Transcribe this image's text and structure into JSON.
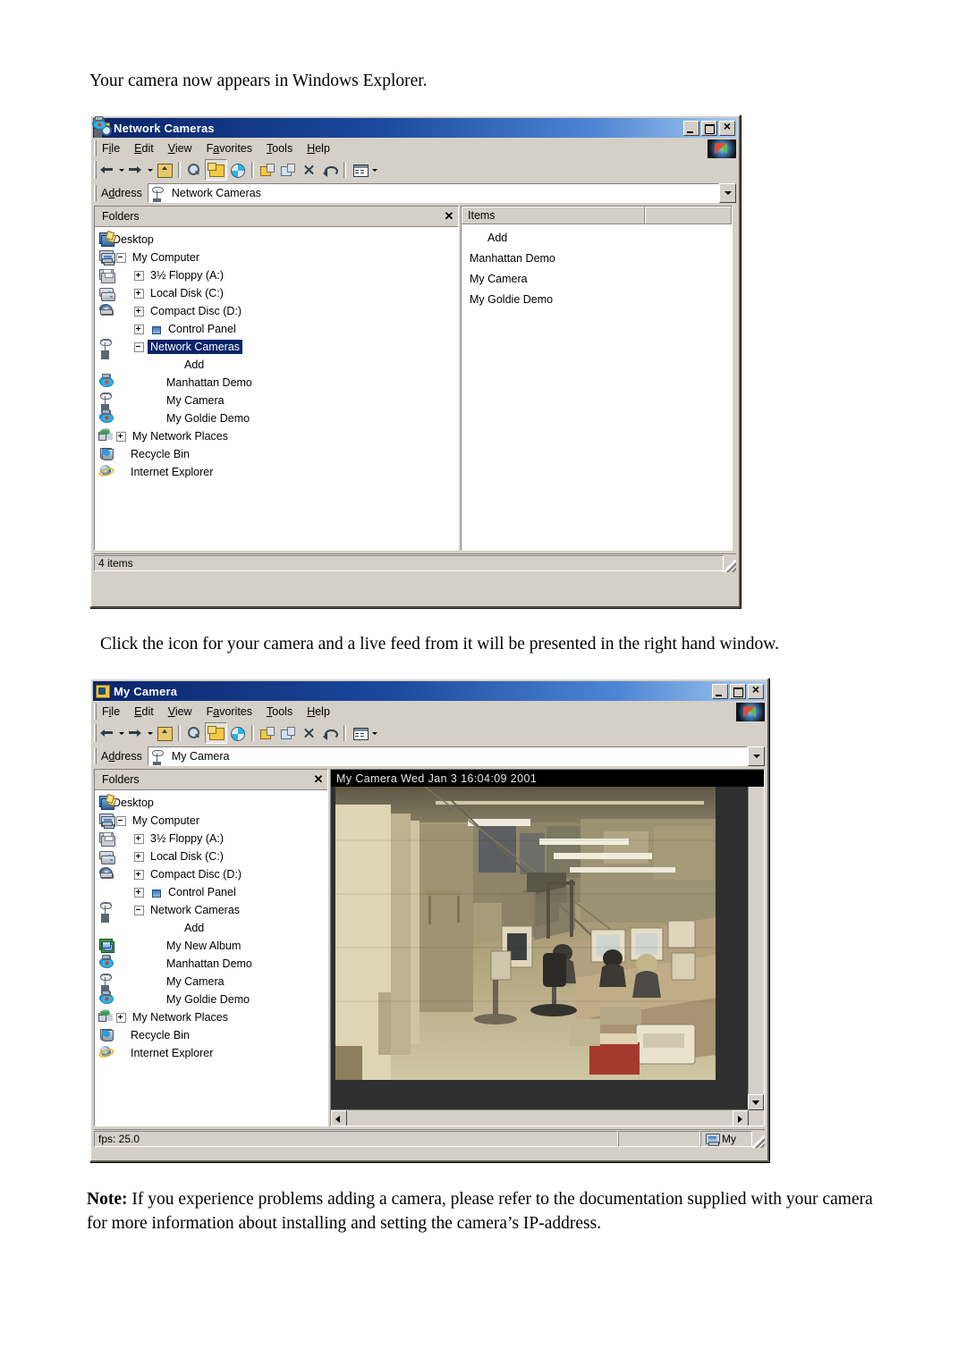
{
  "document": {
    "para_1": "Your camera now appears in Windows Explorer.",
    "para_2": "Click the icon for your camera and a live feed from it will be presented in the right hand window.",
    "note_label": "Note:",
    "note_body": " If you experience problems adding a camera, please refer to the documentation supplied with your camera for more information about installing and setting the camera’s IP-address."
  },
  "window1": {
    "title": "Network Cameras",
    "title_icon": "folder-search-icon",
    "caption_buttons": [
      "minimize",
      "maximize",
      "close"
    ],
    "menu": [
      {
        "pre": "F",
        "key": "i",
        "post": "le",
        "label": "File"
      },
      {
        "pre": "",
        "key": "E",
        "post": "dit",
        "label": "Edit"
      },
      {
        "pre": "",
        "key": "V",
        "post": "iew",
        "label": "View"
      },
      {
        "pre": "F",
        "key": "a",
        "post": "vorites",
        "label": "Favorites"
      },
      {
        "pre": "",
        "key": "T",
        "post": "ools",
        "label": "Tools"
      },
      {
        "pre": "",
        "key": "H",
        "post": "elp",
        "label": "Help"
      }
    ],
    "toolbar": [
      {
        "name": "back-button",
        "glyph": "g-back",
        "caret": true,
        "active": false
      },
      {
        "name": "forward-button",
        "glyph": "g-fwd",
        "caret": true,
        "active": false
      },
      {
        "name": "up-one-level-button",
        "glyph": "g-up",
        "caret": false,
        "active": false
      },
      {
        "name": "search-button",
        "glyph": "g-search",
        "caret": false,
        "active": false
      },
      {
        "name": "folders-button",
        "glyph": "g-folders",
        "caret": false,
        "active": true
      },
      {
        "name": "history-button",
        "glyph": "g-history",
        "caret": false,
        "active": false
      },
      {
        "name": "move-to-button",
        "glyph": "g-move",
        "caret": false,
        "active": false
      },
      {
        "name": "copy-to-button",
        "glyph": "g-copy",
        "caret": false,
        "active": false
      },
      {
        "name": "delete-button",
        "glyph": "g-del",
        "caret": false,
        "active": false
      },
      {
        "name": "undo-button",
        "glyph": "g-undo",
        "caret": false,
        "active": false
      },
      {
        "name": "views-button",
        "glyph": "g-views",
        "caret": true,
        "active": false
      }
    ],
    "address": {
      "label": "Address",
      "value": "Network Cameras",
      "icon": "network-camera-icon"
    },
    "folders_panel": {
      "title": "Folders",
      "close_label": "✕"
    },
    "tree": [
      {
        "label": "Desktop",
        "indent": 0,
        "toggle": "none",
        "icon": "ico-desktop",
        "selected": false
      },
      {
        "label": "My Computer",
        "indent": 1,
        "toggle": "minus",
        "icon": "ico-mycomputer",
        "selected": false
      },
      {
        "label": "3½ Floppy (A:)",
        "indent": 2,
        "toggle": "plus",
        "icon": "ico-floppy",
        "selected": false
      },
      {
        "label": "Local Disk (C:)",
        "indent": 2,
        "toggle": "plus",
        "icon": "ico-disk",
        "selected": false
      },
      {
        "label": "Compact Disc (D:)",
        "indent": 2,
        "toggle": "plus",
        "icon": "ico-cd",
        "selected": false
      },
      {
        "label": "Control Panel",
        "indent": 2,
        "toggle": "plus",
        "icon": "ico-cpanel",
        "selected": false
      },
      {
        "label": "Network Cameras",
        "indent": 2,
        "toggle": "minus",
        "icon": "ico-netcam",
        "selected": true
      },
      {
        "label": "Add",
        "indent": 3,
        "toggle": "none",
        "icon": "ico-add",
        "selected": false
      },
      {
        "label": "Manhattan Demo",
        "indent": 3,
        "toggle": "none",
        "icon": "ico-democam",
        "selected": false
      },
      {
        "label": "My Camera",
        "indent": 3,
        "toggle": "none",
        "icon": "ico-netcam",
        "selected": false
      },
      {
        "label": "My Goldie Demo",
        "indent": 3,
        "toggle": "none",
        "icon": "ico-democam",
        "selected": false
      },
      {
        "label": "My Network Places",
        "indent": 1,
        "toggle": "plus",
        "icon": "ico-netplaces",
        "selected": false
      },
      {
        "label": "Recycle Bin",
        "indent": 1,
        "toggle": "none",
        "icon": "ico-recycle",
        "selected": false
      },
      {
        "label": "Internet Explorer",
        "indent": 1,
        "toggle": "none",
        "icon": "ico-ie",
        "selected": false
      }
    ],
    "list": {
      "column_header": "Items",
      "rows": [
        {
          "label": "Add",
          "icon": "ico-add"
        },
        {
          "label": "Manhattan Demo",
          "icon": "ico-democam"
        },
        {
          "label": "My Camera",
          "icon": "ico-netcam"
        },
        {
          "label": "My Goldie Demo",
          "icon": "ico-democam"
        }
      ]
    },
    "statusbar": {
      "text": "4 items"
    }
  },
  "window2": {
    "title": "My Camera",
    "title_icon": "camera-window-icon",
    "caption_buttons": [
      "minimize",
      "maximize",
      "close"
    ],
    "menu": [
      {
        "pre": "F",
        "key": "i",
        "post": "le",
        "label": "File"
      },
      {
        "pre": "",
        "key": "E",
        "post": "dit",
        "label": "Edit"
      },
      {
        "pre": "",
        "key": "V",
        "post": "iew",
        "label": "View"
      },
      {
        "pre": "F",
        "key": "a",
        "post": "vorites",
        "label": "Favorites"
      },
      {
        "pre": "",
        "key": "T",
        "post": "ools",
        "label": "Tools"
      },
      {
        "pre": "",
        "key": "H",
        "post": "elp",
        "label": "Help"
      }
    ],
    "toolbar": [
      {
        "name": "back-button",
        "glyph": "g-back",
        "caret": true,
        "active": false
      },
      {
        "name": "forward-button",
        "glyph": "g-fwd",
        "caret": true,
        "active": false
      },
      {
        "name": "up-one-level-button",
        "glyph": "g-up",
        "caret": false,
        "active": false
      },
      {
        "name": "search-button",
        "glyph": "g-search",
        "caret": false,
        "active": false
      },
      {
        "name": "folders-button",
        "glyph": "g-folders",
        "caret": false,
        "active": true
      },
      {
        "name": "history-button",
        "glyph": "g-history",
        "caret": false,
        "active": false
      },
      {
        "name": "move-to-button",
        "glyph": "g-move",
        "caret": false,
        "active": false
      },
      {
        "name": "copy-to-button",
        "glyph": "g-copy",
        "caret": false,
        "active": false
      },
      {
        "name": "delete-button",
        "glyph": "g-del",
        "caret": false,
        "active": false
      },
      {
        "name": "undo-button",
        "glyph": "g-undo",
        "caret": false,
        "active": false
      },
      {
        "name": "views-button",
        "glyph": "g-views",
        "caret": true,
        "active": false
      }
    ],
    "address": {
      "label": "Address",
      "value": "My Camera",
      "icon": "network-camera-icon"
    },
    "folders_panel": {
      "title": "Folders",
      "close_label": "✕"
    },
    "tree": [
      {
        "label": "Desktop",
        "indent": 0,
        "toggle": "none",
        "icon": "ico-desktop",
        "selected": false
      },
      {
        "label": "My Computer",
        "indent": 1,
        "toggle": "minus",
        "icon": "ico-mycomputer",
        "selected": false
      },
      {
        "label": "3½ Floppy (A:)",
        "indent": 2,
        "toggle": "plus",
        "icon": "ico-floppy",
        "selected": false
      },
      {
        "label": "Local Disk (C:)",
        "indent": 2,
        "toggle": "plus",
        "icon": "ico-disk",
        "selected": false
      },
      {
        "label": "Compact Disc (D:)",
        "indent": 2,
        "toggle": "plus",
        "icon": "ico-cd",
        "selected": false
      },
      {
        "label": "Control Panel",
        "indent": 2,
        "toggle": "plus",
        "icon": "ico-cpanel",
        "selected": false
      },
      {
        "label": "Network Cameras",
        "indent": 2,
        "toggle": "minus",
        "icon": "ico-netcam",
        "selected": false
      },
      {
        "label": "Add",
        "indent": 3,
        "toggle": "none",
        "icon": "ico-add",
        "selected": false
      },
      {
        "label": "My New Album",
        "indent": 3,
        "toggle": "none",
        "icon": "ico-album",
        "selected": false
      },
      {
        "label": "Manhattan Demo",
        "indent": 3,
        "toggle": "none",
        "icon": "ico-democam",
        "selected": false
      },
      {
        "label": "My Camera",
        "indent": 3,
        "toggle": "none",
        "icon": "ico-netcam",
        "selected": false
      },
      {
        "label": "My Goldie Demo",
        "indent": 3,
        "toggle": "none",
        "icon": "ico-democam",
        "selected": false
      },
      {
        "label": "My Network Places",
        "indent": 1,
        "toggle": "plus",
        "icon": "ico-netplaces",
        "selected": false
      },
      {
        "label": "Recycle Bin",
        "indent": 1,
        "toggle": "none",
        "icon": "ico-recycle",
        "selected": false
      },
      {
        "label": "Internet Explorer",
        "indent": 1,
        "toggle": "none",
        "icon": "ico-ie",
        "selected": false
      }
    ],
    "video": {
      "caption": "My Camera Wed Jan  3 16:04:09 2001",
      "scene_description": "office-lab-webcam-view"
    },
    "statusbar": {
      "fps_text": "fps: 25.0",
      "right_text": "My",
      "right_icon": "computer-icon"
    }
  },
  "colors": {
    "title_active_start": "#0a246a",
    "title_active_end": "#a6caf0",
    "window_face": "#d4d0c8",
    "selection": "#0a246a",
    "video_caption_bg": "#000000"
  }
}
